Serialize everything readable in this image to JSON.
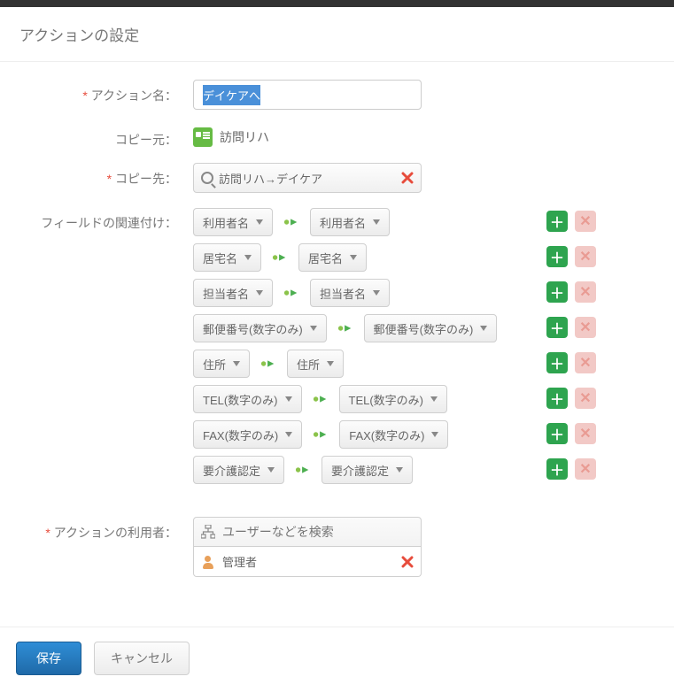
{
  "dialog": {
    "title": "アクションの設定"
  },
  "labels": {
    "actionName": "アクション名：",
    "copyFrom": "コピー元：",
    "copyTo": "コピー先：",
    "fieldMapping": "フィールドの関連付け：",
    "actionUsers": "アクションの利用者："
  },
  "values": {
    "actionName": "デイケアへ",
    "copyFromApp": "訪問リハ",
    "copyTo": "訪問リハ→デイケア",
    "userSearchPlaceholder": "ユーザーなどを検索",
    "userChip": "管理者"
  },
  "fieldMappings": [
    {
      "from": "利用者名",
      "to": "利用者名"
    },
    {
      "from": "居宅名",
      "to": "居宅名"
    },
    {
      "from": "担当者名",
      "to": "担当者名"
    },
    {
      "from": "郵便番号(数字のみ)",
      "to": "郵便番号(数字のみ)"
    },
    {
      "from": "住所",
      "to": "住所"
    },
    {
      "from": "TEL(数字のみ)",
      "to": "TEL(数字のみ)"
    },
    {
      "from": "FAX(数字のみ)",
      "to": "FAX(数字のみ)"
    },
    {
      "from": "要介護認定",
      "to": "要介護認定"
    }
  ],
  "footer": {
    "save": "保存",
    "cancel": "キャンセル"
  }
}
